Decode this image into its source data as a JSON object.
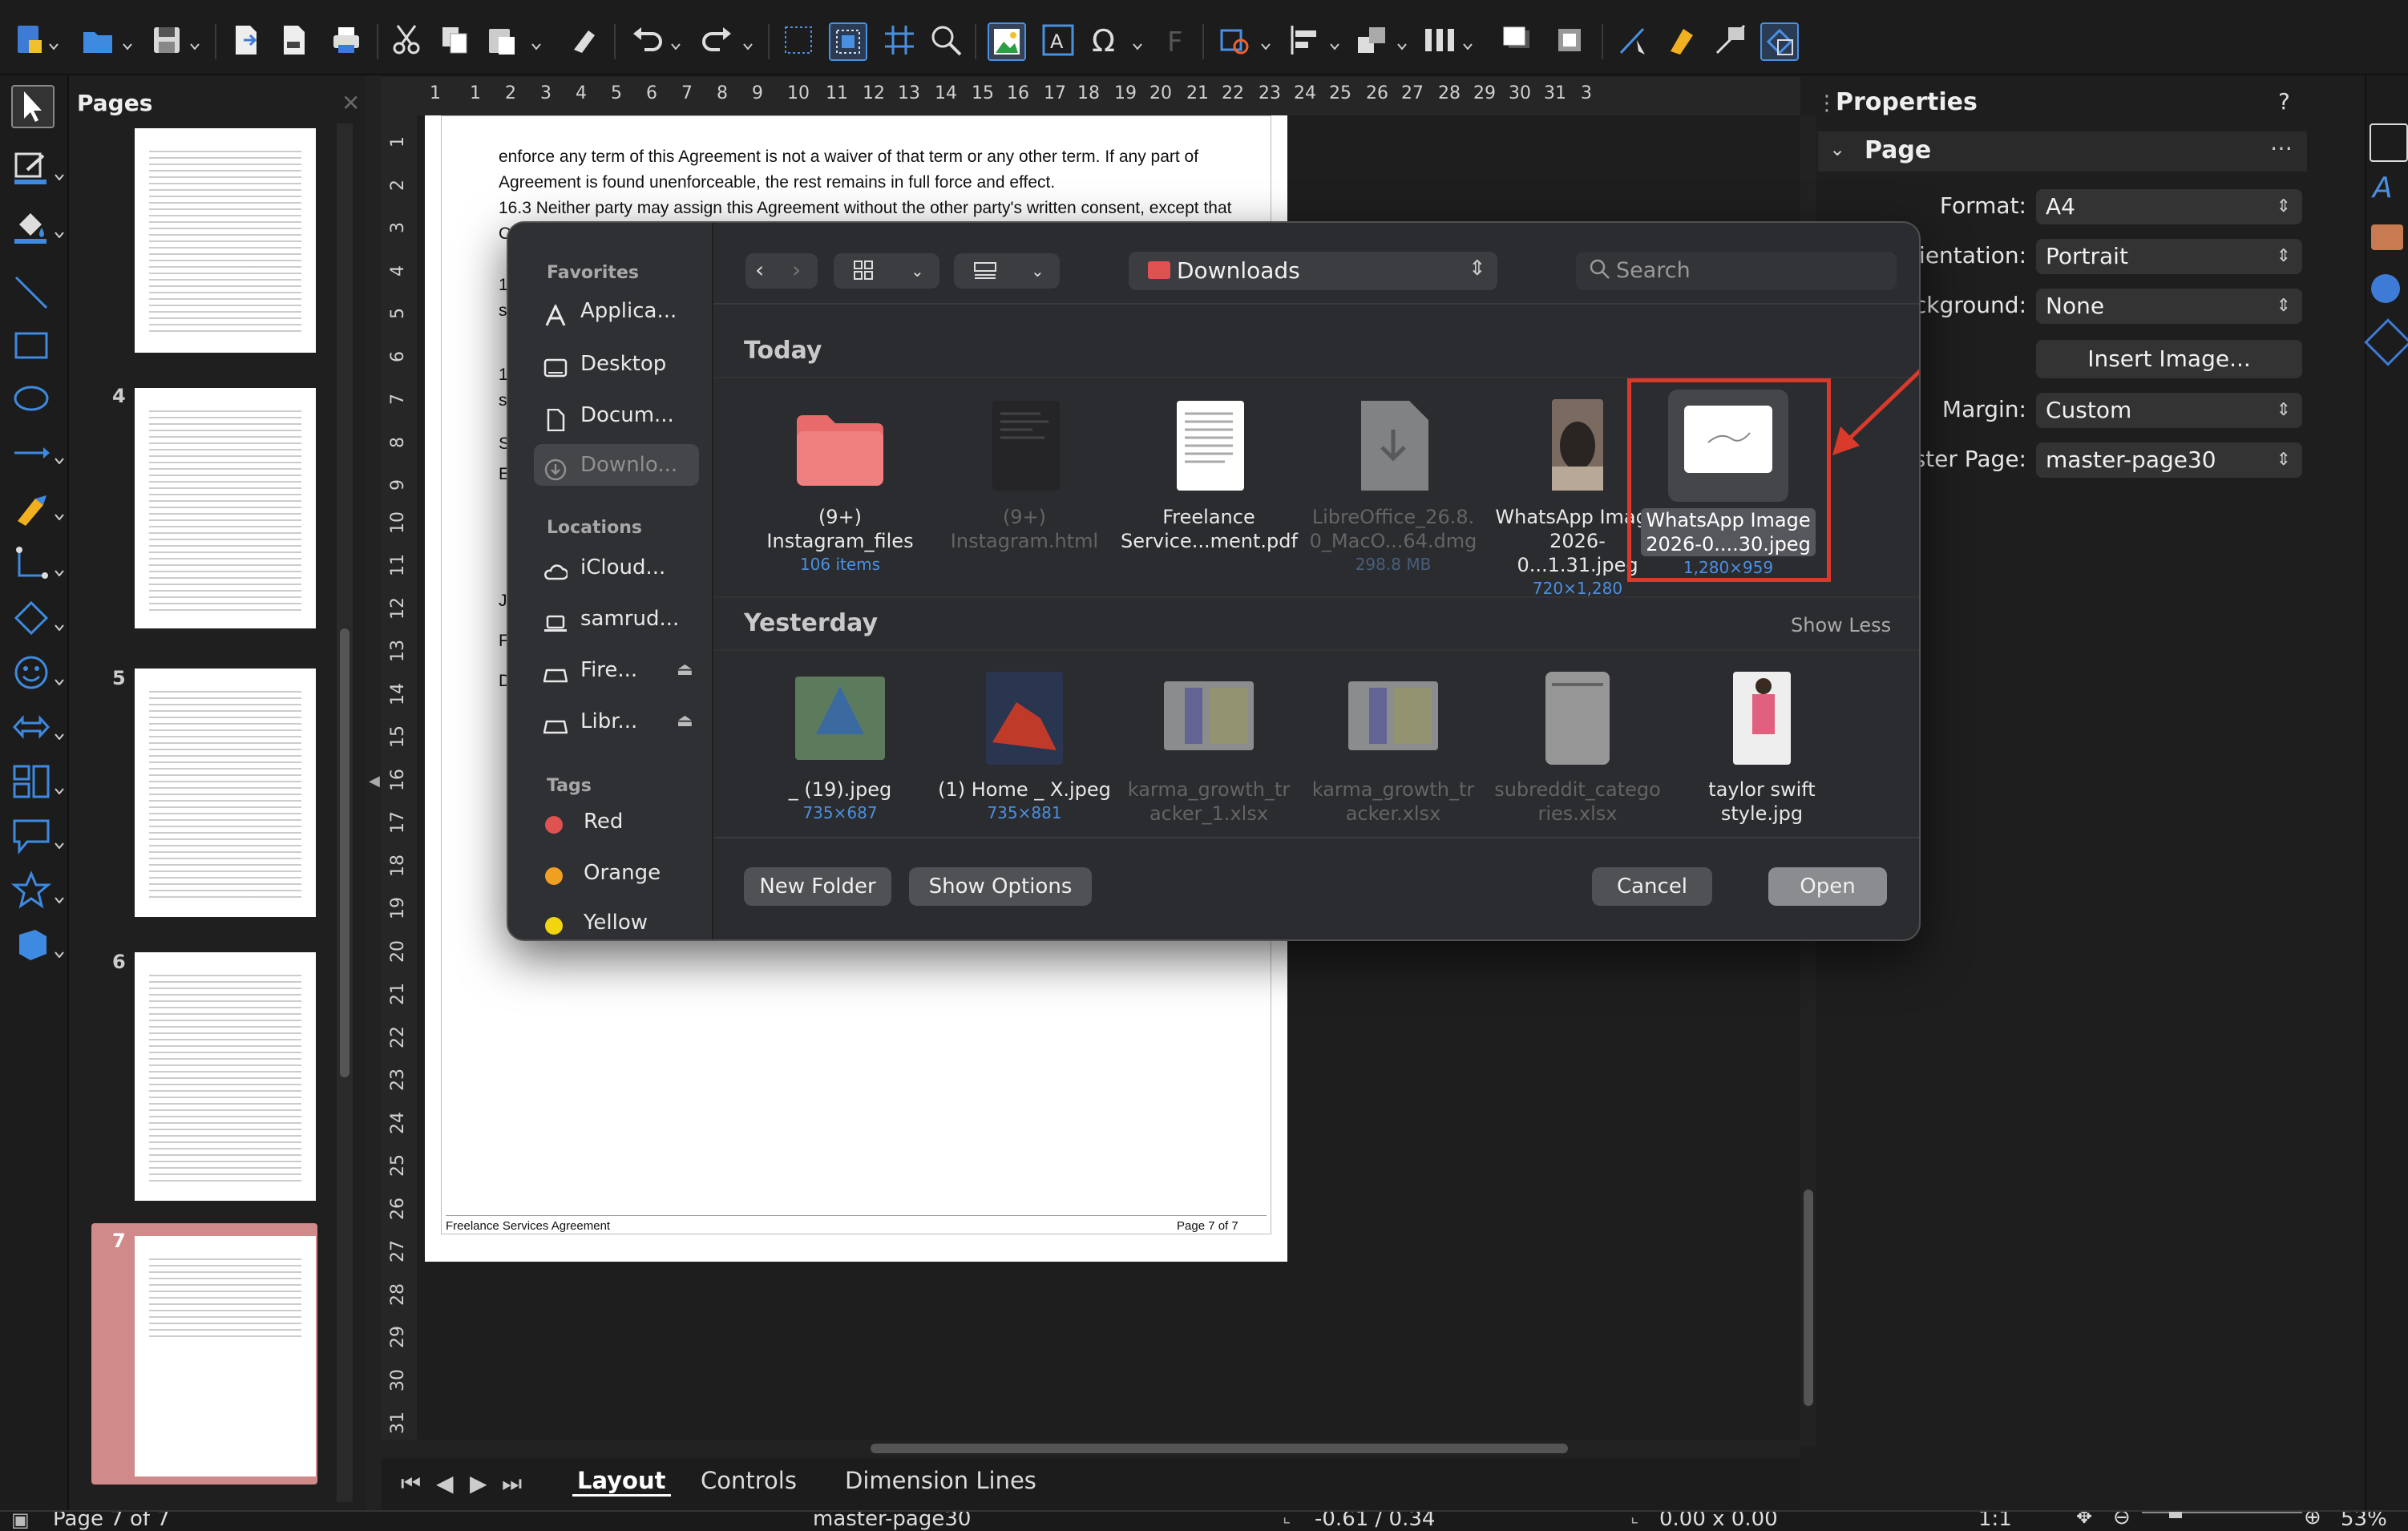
{
  "toolbar": {
    "icons": [
      "new-document-icon",
      "open-folder-icon",
      "save-icon",
      "export-icon",
      "export-pdf-icon",
      "print-icon",
      "cut-icon",
      "copy-icon",
      "paste-icon",
      "clear-format-icon",
      "undo-icon",
      "redo-icon",
      "grid-icon",
      "helplines-icon",
      "snap-icon",
      "zoom-icon",
      "image-icon",
      "textbox-icon",
      "special-character-icon",
      "fontwork-icon",
      "transform-icon",
      "align-icon",
      "arrange-icon",
      "distribute-icon",
      "shadow-icon",
      "crop-icon",
      "points-icon",
      "glue-icon",
      "toggle-extrusion-icon",
      "shape-select-icon"
    ]
  },
  "pages_panel": {
    "title": "Pages",
    "pages": [
      {
        "number": "4"
      },
      {
        "number": "5"
      },
      {
        "number": "6"
      },
      {
        "number": "7"
      }
    ]
  },
  "ruler": {
    "h_ticks": [
      "1",
      "1",
      "2",
      "3",
      "4",
      "5",
      "6",
      "7",
      "8",
      "9",
      "10",
      "11",
      "12",
      "13",
      "14",
      "15",
      "16",
      "17",
      "18",
      "19",
      "20",
      "21",
      "22",
      "23",
      "24",
      "25",
      "26",
      "27",
      "28",
      "29",
      "30",
      "31",
      "3"
    ],
    "v_ticks": [
      "1",
      "2",
      "3",
      "4",
      "5",
      "6",
      "7",
      "8",
      "9",
      "10",
      "11",
      "12",
      "13",
      "14",
      "15",
      "16",
      "17",
      "18",
      "19",
      "20",
      "21",
      "22",
      "23",
      "24",
      "25",
      "26",
      "27",
      "28",
      "29",
      "30",
      "31"
    ]
  },
  "document": {
    "para1": "enforce any term of this Agreement is not a waiver of that term or any other term. If any part of",
    "para1b": "Agreement is found unenforceable, the rest remains in full force and effect.",
    "para2": "16.3 Neither party may assign this Agreement without the other party's written consent, except that",
    "para2b": "Cli",
    "footer_left": "Freelance Services Agreement",
    "footer_right": "Page 7 of 7",
    "left_letters": [
      "1",
      "s",
      "1",
      "s",
      "S",
      "E",
      "J",
      "F",
      "D"
    ]
  },
  "dialog": {
    "sidebar": {
      "favorites_label": "Favorites",
      "favorites": [
        "Applica...",
        "Desktop",
        "Docum...",
        "Downlo..."
      ],
      "locations_label": "Locations",
      "locations": [
        "iCloud...",
        "samrud...",
        "Fire...",
        "Libr..."
      ],
      "tags_label": "Tags",
      "tags": [
        {
          "name": "Red",
          "color": "#e05252"
        },
        {
          "name": "Orange",
          "color": "#f0a020"
        },
        {
          "name": "Yellow",
          "color": "#f2d40f"
        }
      ]
    },
    "location": "Downloads",
    "search_placeholder": "Search",
    "today_label": "Today",
    "yesterday_label": "Yesterday",
    "show_less": "Show Less",
    "today_files": [
      {
        "name1": "(9+)",
        "name2": "Instagram_files",
        "meta": "106 items",
        "kind": "folder"
      },
      {
        "name1": "(9+)",
        "name2": "Instagram.html",
        "meta": "",
        "kind": "html"
      },
      {
        "name1": "Freelance",
        "name2": "Service...ment.pdf",
        "meta": "",
        "kind": "pdf"
      },
      {
        "name1": "LibreOffice_26.8.",
        "name2": "0_MacO...64.dmg",
        "meta": "298.8 MB",
        "kind": "dmg"
      },
      {
        "name1": "WhatsApp Image",
        "name2": "2026-0...1.31.jpeg",
        "meta": "720×1,280",
        "kind": "cat"
      },
      {
        "name1": "WhatsApp Image",
        "name2": "2026-0....30.jpeg",
        "meta": "1,280×959",
        "kind": "signature"
      }
    ],
    "yesterday_files": [
      {
        "name1": "_ (19).jpeg",
        "name2": "",
        "meta": "735×687",
        "kind": "photo-blue"
      },
      {
        "name1": "(1) Home _ X.jpeg",
        "name2": "",
        "meta": "735×881",
        "kind": "photo-red"
      },
      {
        "name1": "karma_growth_tr",
        "name2": "acker_1.xlsx",
        "meta": "",
        "kind": "xlsx"
      },
      {
        "name1": "karma_growth_tr",
        "name2": "acker.xlsx",
        "meta": "",
        "kind": "xlsx"
      },
      {
        "name1": "subreddit_catego",
        "name2": "ries.xlsx",
        "meta": "",
        "kind": "xlsx-grey"
      },
      {
        "name1": "taylor swift",
        "name2": "style.jpg",
        "meta": "",
        "kind": "photo-person"
      }
    ],
    "new_folder": "New Folder",
    "show_options": "Show Options",
    "cancel": "Cancel",
    "open": "Open"
  },
  "properties": {
    "title": "Properties",
    "help": "?",
    "section": "Page",
    "format_label": "Format:",
    "format_value": "A4",
    "orientation_label": "rientation:",
    "orientation_value": "Portrait",
    "background_label": "ckground:",
    "background_value": "None",
    "insert_image": "Insert Image...",
    "margin_label": "Margin:",
    "margin_value": "Custom",
    "master_label": "ster Page:",
    "master_value": "master-page30"
  },
  "tabs": [
    "Layout",
    "Controls",
    "Dimension Lines"
  ],
  "status": {
    "page": "Page 7 of 7",
    "master": "master-page30",
    "position": "-0.61 / 0.34",
    "size": "0.00 x 0.00",
    "scale": "1:1",
    "zoom": "53%"
  },
  "colors": {
    "highlight": "#d93a2b",
    "selected_thumb": "#d08a8a",
    "accent": "#4a90e2"
  }
}
